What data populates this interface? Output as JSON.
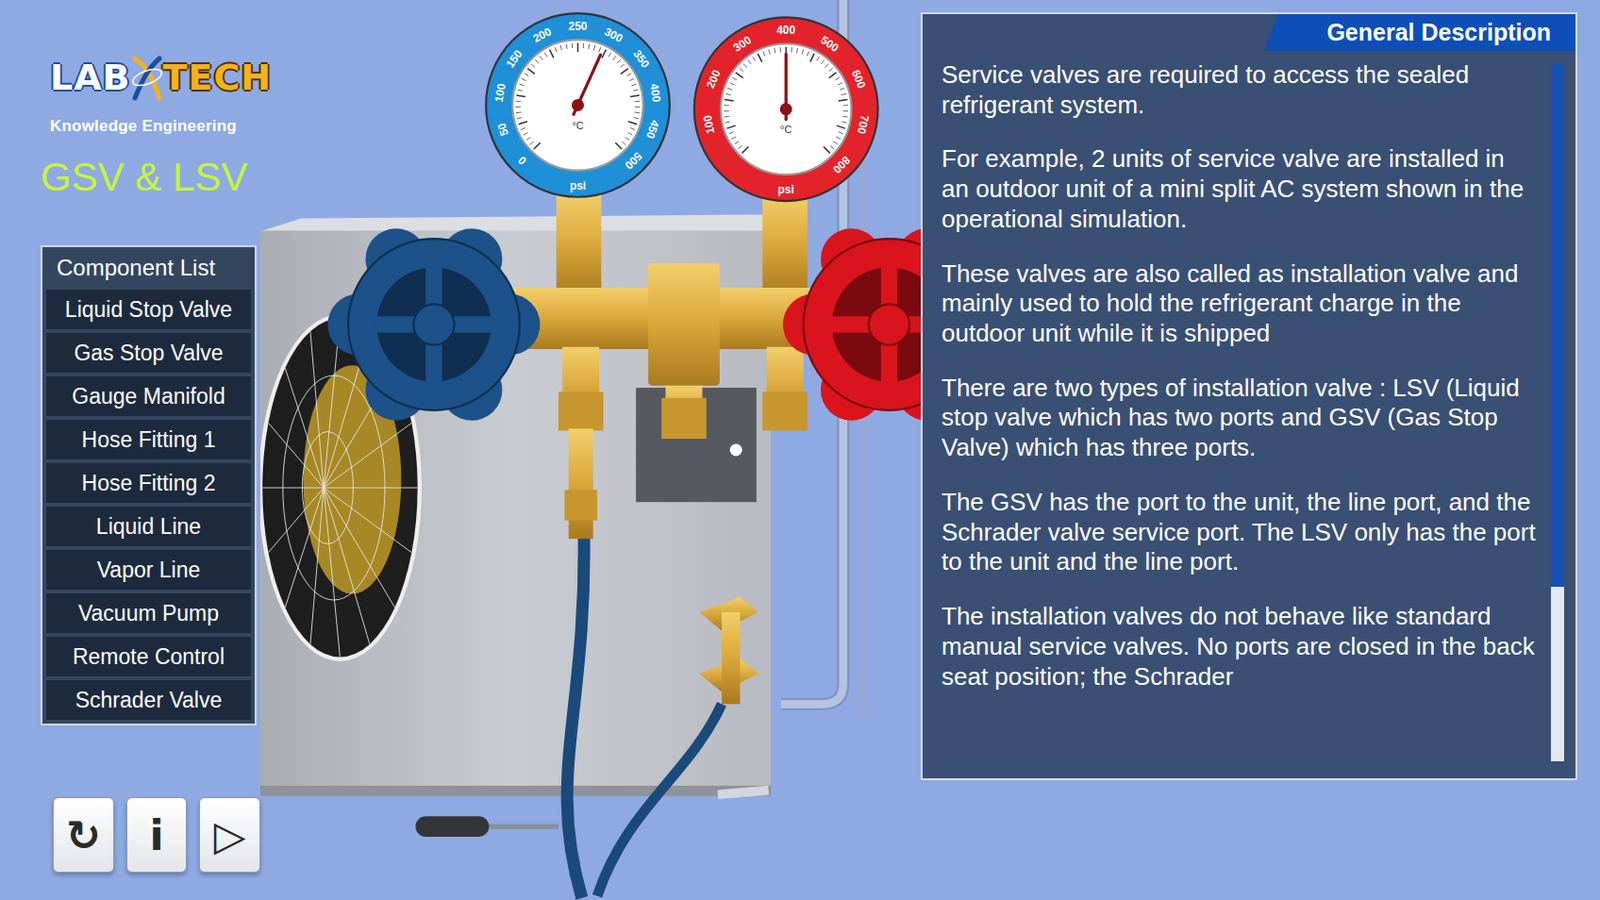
{
  "app": {
    "logo": {
      "left": "LAB",
      "right": "TECH",
      "tagline": "Knowledge Engineering"
    },
    "title": "GSV & LSV"
  },
  "component_list": {
    "title": "Component List",
    "items": [
      {
        "label": "Liquid Stop Valve",
        "selected": false
      },
      {
        "label": "Gas Stop Valve",
        "selected": false
      },
      {
        "label": "Gauge Manifold",
        "selected": false
      },
      {
        "label": "Hose Fitting 1",
        "selected": false
      },
      {
        "label": "Hose Fitting 2",
        "selected": false
      },
      {
        "label": "Liquid Line",
        "selected": false
      },
      {
        "label": "Vapor Line",
        "selected": false
      },
      {
        "label": "Vacuum Pump",
        "selected": false
      },
      {
        "label": "Remote Control",
        "selected": false
      },
      {
        "label": "Schrader Valve",
        "selected": false
      }
    ]
  },
  "toolbar": [
    {
      "label": "↻"
    },
    {
      "label": "i"
    },
    {
      "label": "▷"
    }
  ],
  "simulation": {
    "gauges": [
      {
        "name": "low-side",
        "color": "#1f8fd8",
        "labels": [
          "0",
          "50",
          "100",
          "150",
          "200",
          "250",
          "300",
          "350",
          "400",
          "450",
          "500"
        ],
        "unit": "psi",
        "inner_unit": "°C",
        "level": 0.59
      },
      {
        "name": "high-side",
        "color": "#e3232b",
        "labels": [
          "100",
          "200",
          "300",
          "400",
          "500",
          "600",
          "700",
          "800"
        ],
        "unit": "psi",
        "inner_unit": "°C",
        "level": 0.5
      }
    ]
  },
  "description": {
    "title": "General Description",
    "paragraphs": [
      "Service valves are required to access the sealed refrigerant system.",
      "For example, 2 units of service valve are installed in an outdoor unit of a mini split AC system shown in the operational simulation.",
      "These valves are also called as installation valve and mainly used to hold the refrigerant charge in the outdoor unit while it is shipped",
      "There are two types of installation valve : LSV (Liquid stop valve which has two ports and GSV (Gas Stop Valve) which has three ports.",
      "The GSV has the port to the unit, the line port, and the Schrader valve service port. The LSV only has the port to the unit and the line port.",
      "The installation valves do not behave like standard manual service valves. No ports are closed in the back seat position; the Schrader"
    ],
    "scroll_level": 0.75
  }
}
